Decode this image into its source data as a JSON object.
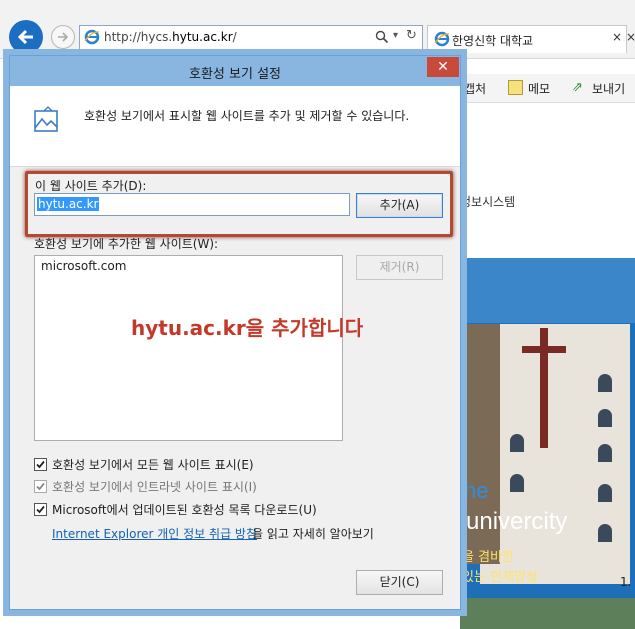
{
  "browser": {
    "url_prefix": "http://hycs.",
    "url_domain": "hytu.ac.kr",
    "url_suffix": "/",
    "tab_title": "한영신학 대학교",
    "tab_close": "×",
    "command_bar": {
      "capture_label": "캡처",
      "memo_label": "메모",
      "send_label": "보내기"
    }
  },
  "page": {
    "info_text": "정보시스템",
    "hero_line_a": "he",
    "hero_line_b": "l univercity",
    "hero_line_c": "을 겸비한",
    "hero_line_d": "있는 인재양성",
    "side_number": "1."
  },
  "dialog": {
    "title": "호환성 보기 설정",
    "close_glyph": "✕",
    "intro_text": "호환성 보기에서 표시할 웹 사이트를 추가 및 제거할 수 있습니다.",
    "add_site_label": "이 웹 사이트 추가(D):",
    "add_site_value": "hytu.ac.kr",
    "add_button": "추가(A)",
    "list_label": "호환성 보기에 추가한 웹 사이트(W):",
    "sites": [
      "microsoft.com"
    ],
    "remove_button": "제거(R)",
    "annotation": "hytu.ac.kr을 추가합니다",
    "options": [
      {
        "label": "호환성 보기에서 모든 웹 사이트 표시(E)",
        "checked": true,
        "disabled": false
      },
      {
        "label": "호환성 보기에서 인트라넷 사이트 표시(I)",
        "checked": true,
        "disabled": true
      },
      {
        "label": "Microsoft에서 업데이트된 호환성 목록 다운로드(U)",
        "checked": true,
        "disabled": false
      }
    ],
    "privacy_link": "Internet Explorer 개인 정보 취급 방침",
    "privacy_rest": "을 읽고 자세히 알아보기",
    "close_button": "닫기(C)"
  },
  "colors": {
    "accent": "#1b6ec2",
    "title_bar": "#89b6e0",
    "close_red": "#c74a3b",
    "annotation_red": "#c33a2a",
    "link": "#1561b3"
  }
}
